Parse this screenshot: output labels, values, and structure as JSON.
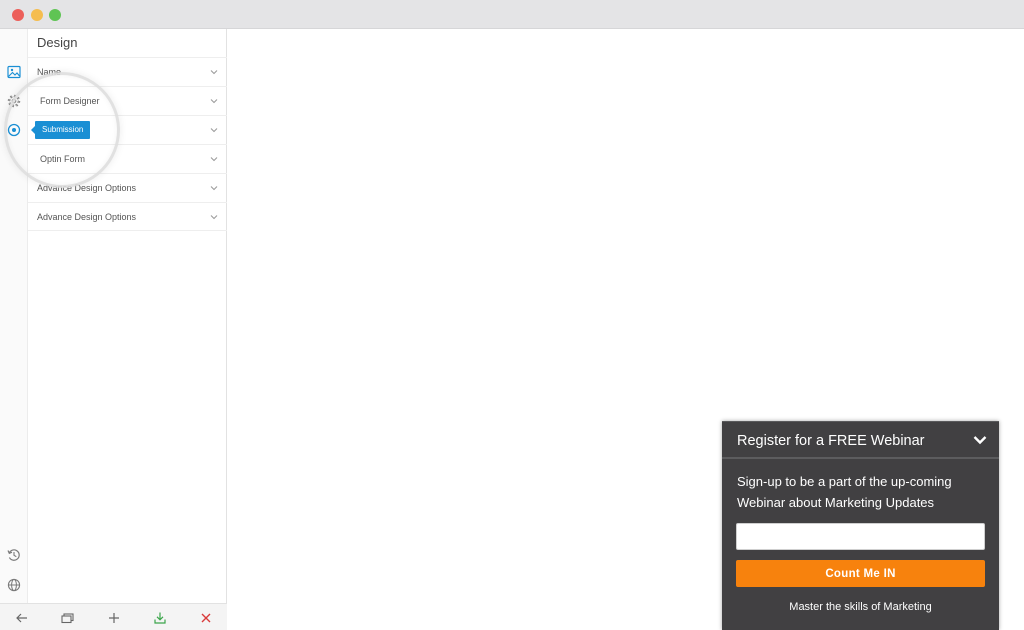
{
  "window": {
    "traffic_lights": [
      "close",
      "minimize",
      "maximize"
    ]
  },
  "icon_rail": {
    "top_icons": [
      "image-icon",
      "gear-icon",
      "target-icon"
    ],
    "bottom_icons": [
      "history-icon",
      "globe-icon"
    ],
    "active_color": "#1a8fd4"
  },
  "panel": {
    "title": "Design",
    "items": [
      {
        "label": "Name"
      },
      {
        "label": "Form Designer"
      },
      {
        "label": "Submission"
      },
      {
        "label": "Optin Form"
      },
      {
        "label": "Advance Design Options"
      },
      {
        "label": "Advance Design Options"
      }
    ],
    "tooltip": "Submission"
  },
  "bottom_bar": {
    "icons": [
      "back-arrow-icon",
      "preview-icon",
      "add-icon",
      "download-icon",
      "close-icon"
    ],
    "colors": {
      "download": "#3aa54a",
      "close": "#d93a3a"
    }
  },
  "widget": {
    "title": "Register for a FREE Webinar",
    "description": "Sign-up to be a part of the up-coming Webinar about Marketing Updates",
    "input_value": "",
    "button_label": "Count Me IN",
    "footer": "Master the skills of Marketing",
    "colors": {
      "background": "#414042",
      "button": "#f7820d"
    }
  }
}
